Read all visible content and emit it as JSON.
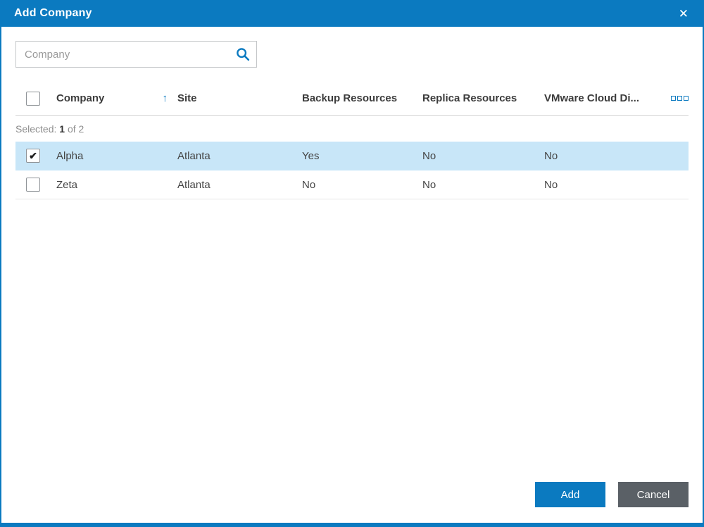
{
  "dialog": {
    "title": "Add Company",
    "close_icon": "✕"
  },
  "search": {
    "placeholder": "Company"
  },
  "table": {
    "columns": [
      "Company",
      "Site",
      "Backup Resources",
      "Replica Resources",
      "VMware Cloud Di..."
    ],
    "sort_icon": "↑",
    "selected_label": "Selected:",
    "selected_count": "1",
    "selected_total": "of 2",
    "rows": [
      {
        "checked_attr": "checked",
        "company": "Alpha",
        "site": "Atlanta",
        "backup": "Yes",
        "replica": "No",
        "vmware": "No"
      },
      {
        "company": "Zeta",
        "site": "Atlanta",
        "backup": "No",
        "replica": "No",
        "vmware": "No"
      }
    ]
  },
  "footer": {
    "add_label": "Add",
    "cancel_label": "Cancel"
  },
  "colors": {
    "accent": "#0b7ac0",
    "selected_row": "#c8e6f8",
    "button_dark": "#5a6066"
  }
}
